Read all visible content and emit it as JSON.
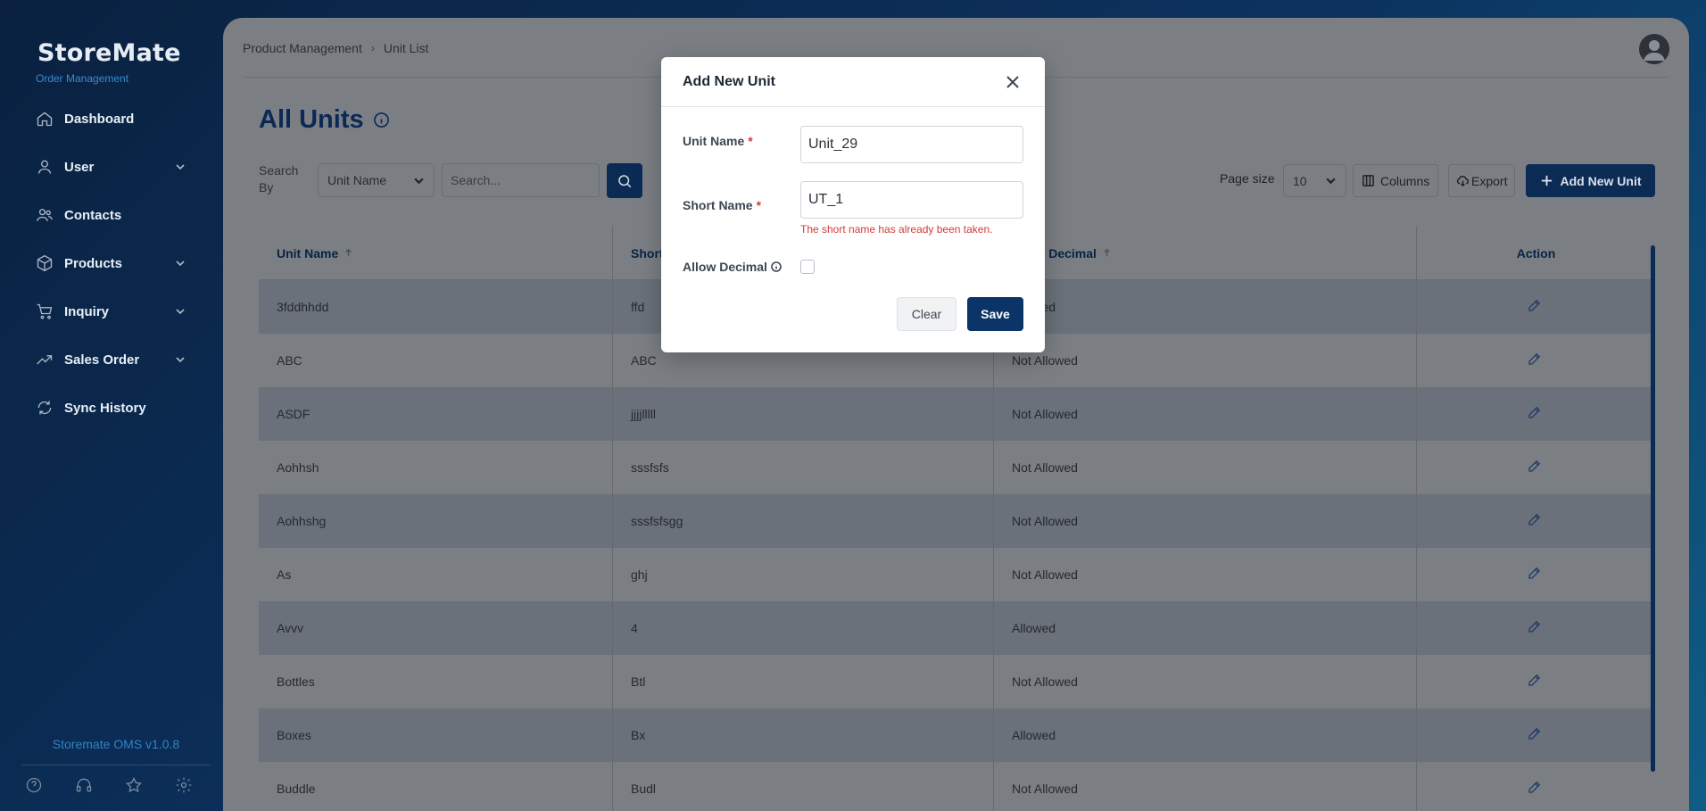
{
  "brand": {
    "name": "StoreMate",
    "subtitle": "Order Management"
  },
  "sidebar": {
    "items": [
      {
        "label": "Dashboard",
        "icon": "home-icon",
        "has_children": false
      },
      {
        "label": "User",
        "icon": "user-icon",
        "has_children": true
      },
      {
        "label": "Contacts",
        "icon": "contacts-icon",
        "has_children": false
      },
      {
        "label": "Products",
        "icon": "box-icon",
        "has_children": true
      },
      {
        "label": "Inquiry",
        "icon": "cart-icon",
        "has_children": true
      },
      {
        "label": "Sales Order",
        "icon": "trending-up-icon",
        "has_children": true
      },
      {
        "label": "Sync History",
        "icon": "sync-icon",
        "has_children": false
      }
    ],
    "version": "Storemate OMS v1.0.8",
    "footer_icons": [
      "help-icon",
      "headset-icon",
      "star-icon",
      "gear-icon"
    ]
  },
  "breadcrumb": {
    "parent": "Product Management",
    "separator": "›",
    "current": "Unit List"
  },
  "page": {
    "title": "All Units"
  },
  "search": {
    "label": "Search By",
    "field_value": "Unit Name",
    "placeholder": "Search..."
  },
  "toolbar": {
    "page_size_label": "Page size",
    "page_size_value": "10",
    "columns_label": "Columns",
    "export_label": "Export",
    "add_label": "Add New Unit"
  },
  "table": {
    "columns": [
      "Unit Name",
      "Short Name",
      "Allow Decimal",
      "Action"
    ],
    "rows": [
      {
        "unit": "3fddhhdd",
        "short": "ffd",
        "decimal": "Allowed"
      },
      {
        "unit": "ABC",
        "short": "ABC",
        "decimal": "Not Allowed"
      },
      {
        "unit": "ASDF",
        "short": "jjjjlllll",
        "decimal": "Not Allowed"
      },
      {
        "unit": "Aohhsh",
        "short": "sssfsfs",
        "decimal": "Not Allowed"
      },
      {
        "unit": "Aohhshg",
        "short": "sssfsfsgg",
        "decimal": "Not Allowed"
      },
      {
        "unit": "As",
        "short": "ghj",
        "decimal": "Not Allowed"
      },
      {
        "unit": "Avvv",
        "short": "4",
        "decimal": "Allowed"
      },
      {
        "unit": "Bottles",
        "short": "Btl",
        "decimal": "Not Allowed"
      },
      {
        "unit": "Boxes",
        "short": "Bx",
        "decimal": "Allowed"
      },
      {
        "unit": "Buddle",
        "short": "Budl",
        "decimal": "Not Allowed"
      }
    ]
  },
  "modal": {
    "title": "Add New Unit",
    "unit_name_label": "Unit Name",
    "unit_name_value": "Unit_29",
    "short_name_label": "Short Name",
    "short_name_value": "UT_1",
    "short_name_error": "The short name has already been taken.",
    "allow_decimal_label": "Allow Decimal",
    "allow_decimal_checked": false,
    "required_mark": "*",
    "clear_label": "Clear",
    "save_label": "Save"
  },
  "colors": {
    "primary": "#0b2b54",
    "error": "#d43a3a",
    "link": "#2f83c6"
  }
}
